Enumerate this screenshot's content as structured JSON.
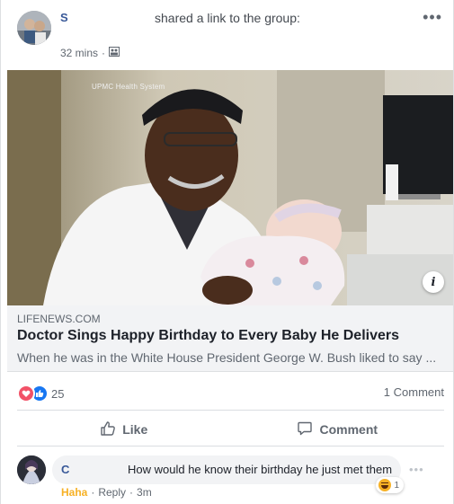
{
  "post": {
    "author_initial": "S",
    "shared_text_prefix": "shared a ",
    "shared_text_link": "link",
    "shared_text_suffix": " to the group:",
    "time": "32 mins",
    "time_separator": "·",
    "audience_icon": "group-icon",
    "more_icon": "more-dots-icon",
    "more_label": "•••"
  },
  "media": {
    "watermark": "UPMC Health System",
    "info_label": "i"
  },
  "link_preview": {
    "domain": "LIFENEWS.COM",
    "headline": "Doctor Sings Happy Birthday to Every Baby He Delivers",
    "description": "When he was in the White House President George W. Bush liked to say ..."
  },
  "engagement": {
    "reaction_icons": [
      "love-icon",
      "like-icon"
    ],
    "reaction_count": "25",
    "comment_count": "1 Comment"
  },
  "actions": {
    "like_label": "Like",
    "comment_label": "Comment"
  },
  "comment": {
    "author_initial": "C",
    "text": "How would he know their birthday he just met them",
    "reaction_icon": "haha-icon",
    "reaction_count": "1",
    "haha_label": "Haha",
    "separator": "·",
    "reply_label": "Reply",
    "time": "3m",
    "more_label": "•••"
  },
  "colors": {
    "link_blue": "#385898",
    "meta_gray": "#606770",
    "love_red": "#f25268",
    "like_blue": "#1877f2",
    "haha_yellow": "#f7b125"
  }
}
